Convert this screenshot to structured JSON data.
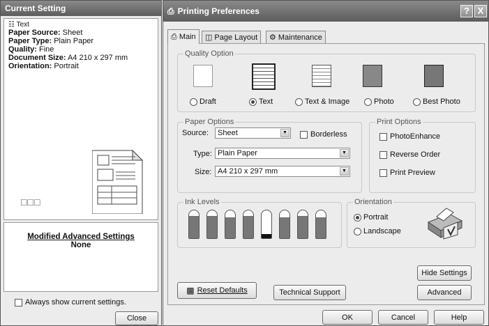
{
  "current_setting": {
    "title": "Current Setting",
    "media_label": "Text",
    "rows": [
      {
        "key": "Paper Source:",
        "value": "Sheet"
      },
      {
        "key": "Paper Type:",
        "value": "Plain Paper"
      },
      {
        "key": "Quality:",
        "value": "Fine"
      },
      {
        "key": "Document Size:",
        "value": "A4 210 x 297 mm"
      },
      {
        "key": "Orientation:",
        "value": "Portrait"
      }
    ],
    "modified_title": "Modified Advanced Settings",
    "modified_value": "None",
    "always_show_label": "Always show current settings.",
    "close_label": "Close"
  },
  "prefs": {
    "title": "Printing Preferences",
    "help_btn": "?",
    "close_btn": "X",
    "tabs": [
      {
        "label": "Main",
        "icon": "printer-icon"
      },
      {
        "label": "Page Layout",
        "icon": "layout-icon"
      },
      {
        "label": "Maintenance",
        "icon": "maintenance-icon"
      }
    ],
    "quality": {
      "legend": "Quality Option",
      "options": [
        "Draft",
        "Text",
        "Text & Image",
        "Photo",
        "Best Photo"
      ],
      "selected": "Text"
    },
    "paper": {
      "legend": "Paper Options",
      "source_label": "Source:",
      "source_value": "Sheet",
      "borderless_label": "Borderless",
      "type_label": "Type:",
      "type_value": "Plain Paper",
      "size_label": "Size:",
      "size_value": "A4 210 x 297 mm"
    },
    "print_options": {
      "legend": "Print Options",
      "items": [
        "PhotoEnhance",
        "Reverse Order",
        "Print Preview"
      ]
    },
    "ink": {
      "legend": "Ink Levels",
      "levels": [
        0.8,
        0.8,
        0.75,
        0.8,
        0.15,
        0.75,
        0.8,
        0.75
      ]
    },
    "orientation": {
      "legend": "Orientation",
      "portrait": "Portrait",
      "landscape": "Landscape",
      "selected": "Portrait"
    },
    "buttons": {
      "hide_settings": "Hide Settings",
      "reset_defaults": "Reset Defaults",
      "technical_support": "Technical Support",
      "advanced": "Advanced",
      "ok": "OK",
      "cancel": "Cancel",
      "help": "Help"
    }
  }
}
